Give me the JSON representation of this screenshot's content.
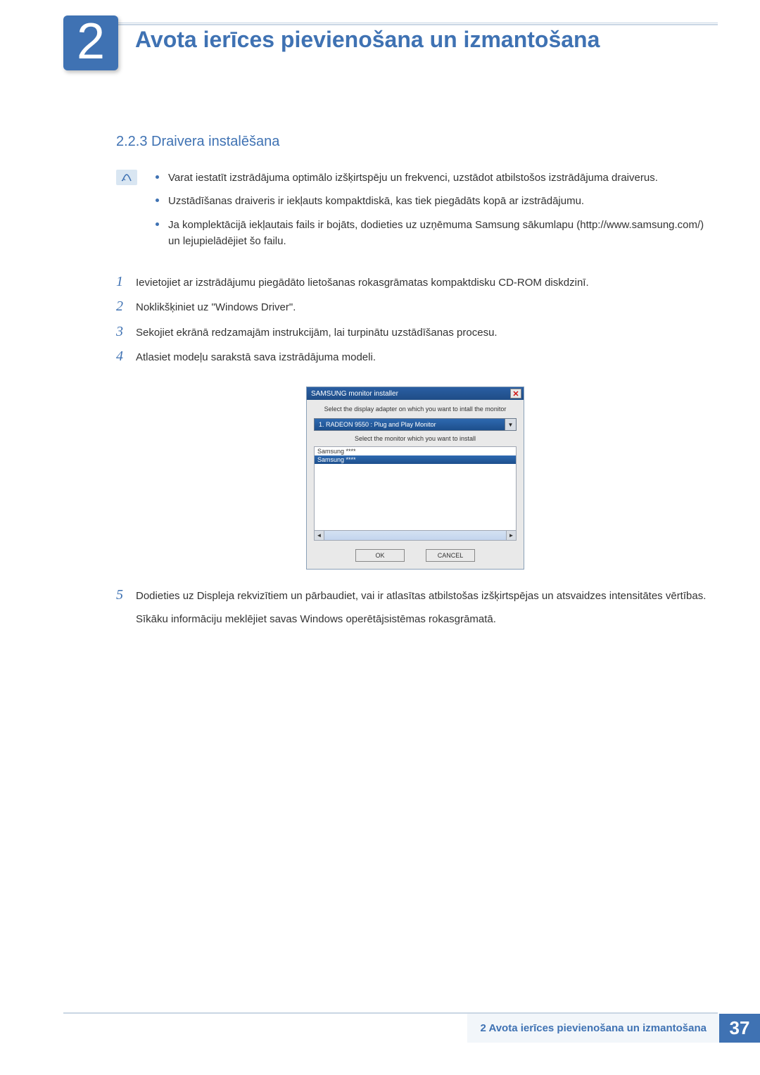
{
  "chapter": {
    "number": "2",
    "title": "Avota ierīces pievienošana un izmantošana"
  },
  "subsection": {
    "number_title": "2.2.3  Draivera instalēšana"
  },
  "notes": [
    "Varat iestatīt izstrādājuma optimālo izšķirtspēju un frekvenci, uzstādot atbilstošos izstrādājuma draiverus.",
    "Uzstādīšanas draiveris ir iekļauts kompaktdiskā, kas tiek piegādāts kopā ar izstrādājumu.",
    "Ja komplektācijā iekļautais fails ir bojāts, dodieties uz uzņēmuma Samsung sākumlapu (http://www.samsung.com/) un lejupielādējiet šo failu."
  ],
  "steps": [
    {
      "n": "1",
      "t": "Ievietojiet ar izstrādājumu piegādāto lietošanas rokasgrāmatas kompaktdisku CD-ROM diskdzinī."
    },
    {
      "n": "2",
      "t": "Noklikšķiniet uz \"Windows Driver\"."
    },
    {
      "n": "3",
      "t": "Sekojiet ekrānā redzamajām instrukcijām, lai turpinātu uzstādīšanas procesu."
    },
    {
      "n": "4",
      "t": "Atlasiet modeļu sarakstā sava izstrādājuma modeli."
    },
    {
      "n": "5",
      "t": "Dodieties uz Displeja rekvizītiem un pārbaudiet, vai ir atlasītas atbilstošas izšķirtspējas un atsvaidzes intensitātes vērtības."
    }
  ],
  "step5_extra": "Sīkāku informāciju meklējiet savas Windows operētājsistēmas rokasgrāmatā.",
  "installer": {
    "title": "SAMSUNG monitor installer",
    "msg1": "Select the display adapter on which you want to intall the monitor",
    "adapter": "1. RADEON 9550 : Plug and Play Monitor",
    "msg2": "Select the monitor which you want to install",
    "rows": [
      "Samsung ****",
      "Samsung ****"
    ],
    "ok": "OK",
    "cancel": "CANCEL"
  },
  "footer": {
    "label": "2 Avota ierīces pievienošana un izmantošana",
    "page": "37"
  }
}
